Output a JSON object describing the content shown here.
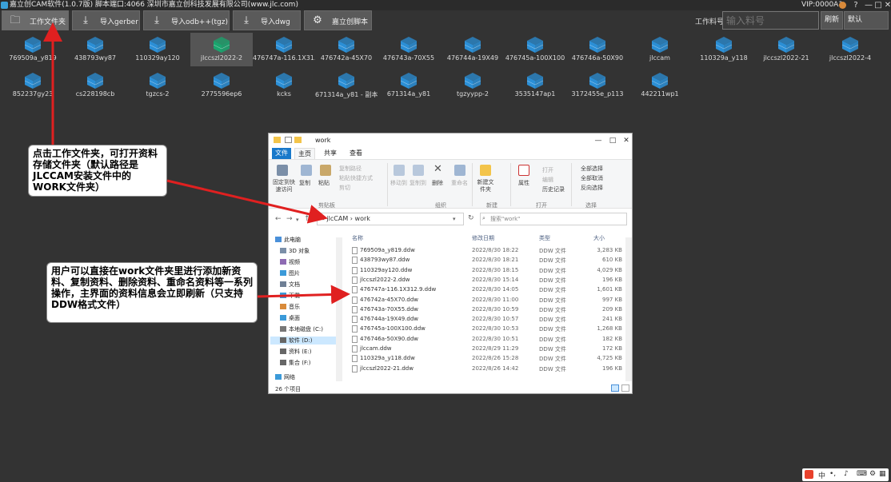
{
  "titlebar": {
    "title": "嘉立创CAM软件(1.0.7版) 脚本端口:4066 深圳市嘉立创科技发展有限公司(www.jlc.com)",
    "vip": "VIP:0000A1",
    "minimize": "—",
    "restore": "□",
    "close": "✕",
    "help": "?"
  },
  "toolbar": {
    "buttons": [
      {
        "label": "工作文件夹",
        "icon": "folder-icon"
      },
      {
        "label": "导入gerber",
        "icon": "import-icon"
      },
      {
        "label": "导入odb++(tgz)",
        "icon": "import-icon"
      },
      {
        "label": "导入dwg",
        "icon": "import-icon"
      },
      {
        "label": "嘉立创脚本",
        "icon": "gear-icon"
      }
    ],
    "work_label": "工作料号:",
    "work_placeholder": "输入料号",
    "refresh": "刷新",
    "default": "默认"
  },
  "folders": [
    {
      "name": "769509a_y819"
    },
    {
      "name": "438793wy87"
    },
    {
      "name": "110329ay120"
    },
    {
      "name": "jlccszl2022-2",
      "selected": true
    },
    {
      "name": "476747a-116.1X31..."
    },
    {
      "name": "476742a-45X70"
    },
    {
      "name": "476743a-70X55"
    },
    {
      "name": "476744a-19X49"
    },
    {
      "name": "476745a-100X100"
    },
    {
      "name": "476746a-50X90"
    },
    {
      "name": "jlccam"
    },
    {
      "name": "110329a_y118"
    },
    {
      "name": "jlccszl2022-21"
    },
    {
      "name": "jlccszl2022-4"
    },
    {
      "name": "852237gy23"
    },
    {
      "name": "cs228198cb"
    },
    {
      "name": "tgzcs-2"
    },
    {
      "name": "2775596ep6"
    },
    {
      "name": "kcks"
    },
    {
      "name": "671314a_y81 - 副本"
    },
    {
      "name": "671314a_y81"
    },
    {
      "name": "tgzyypp-2"
    },
    {
      "name": "3535147ap1"
    },
    {
      "name": "3172455e_p113"
    },
    {
      "name": "442211wp1"
    }
  ],
  "callouts": {
    "first": "点击工作文件夹，可打开资料存储文件夹（默认路径是JLCCAM安装文件中的WORK文件夹）",
    "second": "用户可以直接在work文件夹里进行添加新资料、复制资料、删除资料、重命名资料等一系列操作，主界面的资料信息会立即刷新（只支持DDW格式文件）"
  },
  "explorer": {
    "title": "work",
    "tabs": [
      "文件",
      "主页",
      "共享",
      "查看"
    ],
    "ribbon": {
      "pin": "固定到快速访问",
      "copy": "复制",
      "paste": "粘贴",
      "copy_path": "复制路径",
      "paste_shortcut": "粘贴快捷方式",
      "cut": "剪切",
      "clipboard": "剪贴板",
      "move_to": "移动到",
      "copy_to": "复制到",
      "delete": "删除",
      "rename": "重命名",
      "organize": "组织",
      "new_folder": "新建文件夹",
      "new": "新建",
      "properties": "属性",
      "open": "打开",
      "edit": "编辑",
      "history": "历史记录",
      "open_group": "打开",
      "select_all": "全部选择",
      "select_none": "全部取消",
      "invert": "反向选择",
      "select_group": "选择"
    },
    "address": "« jlcCAM › work",
    "search_placeholder": "搜索\"work\"",
    "nav": [
      {
        "label": "此电脑"
      },
      {
        "label": "3D 对象"
      },
      {
        "label": "视频"
      },
      {
        "label": "图片"
      },
      {
        "label": "文档"
      },
      {
        "label": "下载"
      },
      {
        "label": "音乐"
      },
      {
        "label": "桌面"
      },
      {
        "label": "本地磁盘 (C:)"
      },
      {
        "label": "软件 (D:)",
        "selected": true
      },
      {
        "label": "资料 (E:)"
      },
      {
        "label": "集合 (F:)"
      },
      {
        "label": "网络"
      }
    ],
    "columns": {
      "name": "名称",
      "date": "修改日期",
      "type": "类型",
      "size": "大小"
    },
    "files": [
      {
        "name": "769509a_y819.ddw",
        "date": "2022/8/30 18:22",
        "type": "DDW 文件",
        "size": "3,283 KB"
      },
      {
        "name": "438793wy87.ddw",
        "date": "2022/8/30 18:21",
        "type": "DDW 文件",
        "size": "610 KB"
      },
      {
        "name": "110329ay120.ddw",
        "date": "2022/8/30 18:15",
        "type": "DDW 文件",
        "size": "4,029 KB"
      },
      {
        "name": "jlccszl2022-2.ddw",
        "date": "2022/8/30 15:14",
        "type": "DDW 文件",
        "size": "196 KB"
      },
      {
        "name": "476747a-116.1X312.9.ddw",
        "date": "2022/8/30 14:05",
        "type": "DDW 文件",
        "size": "1,601 KB"
      },
      {
        "name": "476742a-45X70.ddw",
        "date": "2022/8/30 11:00",
        "type": "DDW 文件",
        "size": "997 KB"
      },
      {
        "name": "476743a-70X55.ddw",
        "date": "2022/8/30 10:59",
        "type": "DDW 文件",
        "size": "209 KB"
      },
      {
        "name": "476744a-19X49.ddw",
        "date": "2022/8/30 10:57",
        "type": "DDW 文件",
        "size": "241 KB"
      },
      {
        "name": "476745a-100X100.ddw",
        "date": "2022/8/30 10:53",
        "type": "DDW 文件",
        "size": "1,268 KB"
      },
      {
        "name": "476746a-50X90.ddw",
        "date": "2022/8/30 10:51",
        "type": "DDW 文件",
        "size": "182 KB"
      },
      {
        "name": "jlccam.ddw",
        "date": "2022/8/29 11:29",
        "type": "DDW 文件",
        "size": "172 KB"
      },
      {
        "name": "110329a_y118.ddw",
        "date": "2022/8/26 15:28",
        "type": "DDW 文件",
        "size": "4,725 KB"
      },
      {
        "name": "jlccszl2022-21.ddw",
        "date": "2022/8/26 14:42",
        "type": "DDW 文件",
        "size": "196 KB"
      }
    ],
    "status": "26 个项目"
  },
  "tray": {
    "ime": "中",
    "dot": "•,"
  },
  "colors": {
    "background": "#333333",
    "toolbar": "#5a5a5a",
    "cube_blue": "#2b8fd6",
    "cube_green": "#1aa56e",
    "arrow": "#e02020"
  }
}
